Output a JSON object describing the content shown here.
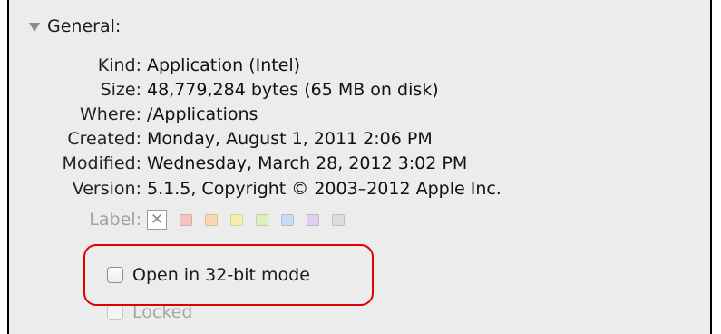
{
  "section": {
    "title": "General:"
  },
  "info": {
    "kind": {
      "label": "Kind:",
      "value": "Application (Intel)"
    },
    "size": {
      "label": "Size:",
      "value": "48,779,284 bytes (65 MB on disk)"
    },
    "where": {
      "label": "Where:",
      "value": "/Applications"
    },
    "created": {
      "label": "Created:",
      "value": "Monday, August 1, 2011 2:06 PM"
    },
    "modified": {
      "label": "Modified:",
      "value": "Wednesday, March 28, 2012 3:02 PM"
    },
    "version": {
      "label": "Version:",
      "value": "5.1.5, Copyright © 2003–2012 Apple Inc."
    }
  },
  "label_picker": {
    "label": "Label:",
    "none_glyph": "✕",
    "colors": [
      "#f6c3c3",
      "#f7d9b0",
      "#f6efaa",
      "#ddf0bf",
      "#c5def6",
      "#e3cdf1",
      "#dcdcdc"
    ]
  },
  "options": {
    "open_32bit": {
      "label": "Open in 32-bit mode",
      "checked": false
    },
    "locked": {
      "label": "Locked",
      "checked": false,
      "disabled": true
    }
  },
  "annotation": {
    "color": "#e00000"
  }
}
